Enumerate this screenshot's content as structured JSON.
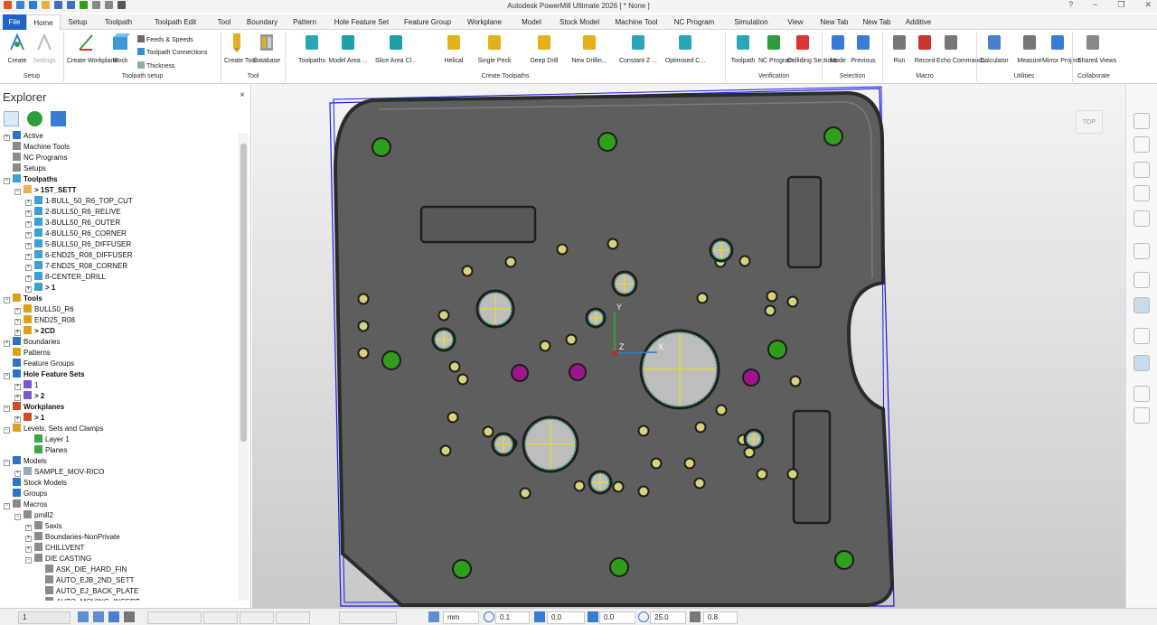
{
  "app_title": "Autodesk PowerMill Ultimate 2026   [ * None ]",
  "colors": {
    "accent": "#1e64c8",
    "viewport_part": "#5e5e5e",
    "hole_green": "#2f9e1a",
    "hole_magenta": "#a0148f",
    "bbox": "#1a1ae6"
  },
  "menu": {
    "tabs": [
      "File",
      "Home",
      "Setup",
      "Toolpath",
      "Toolpath Edit",
      "Tool",
      "Boundary",
      "Pattern",
      "Hole Feature Set",
      "Feature Group",
      "Workplane",
      "Model",
      "Stock Model",
      "Machine Tool",
      "NC Program",
      "Simulation",
      "View",
      "New Tab",
      "New Tab",
      "Additive"
    ],
    "active": "Home"
  },
  "ribbon": {
    "setup": {
      "create": "Create",
      "settings": "Settings",
      "group": "Setup"
    },
    "toolpath_setup": {
      "create_workplane": "Create Workplane",
      "block": "Block",
      "feeds": "Feeds & Speeds",
      "connections": "Toolpath Connections",
      "thickness": "Thickness",
      "group": "Toolpath setup"
    },
    "tool": {
      "create_tool": "Create Tool",
      "database": "Database",
      "group": "Tool"
    },
    "create_toolpaths": {
      "items": [
        "Toolpaths",
        "Model Area ...",
        "Slice Area Cl...",
        "Helical",
        "Single Peck",
        "Deep Drill",
        "New Drillin...",
        "Constant Z ...",
        "Optimised C..."
      ],
      "group": "Create Toolpaths"
    },
    "verification": {
      "items": [
        "Toolpath",
        "NC Program",
        "Colliding Sections"
      ],
      "group": "Verification"
    },
    "selection": {
      "items": [
        "Mode",
        "Previous"
      ],
      "group": "Selection"
    },
    "macro": {
      "items": [
        "Run",
        "Record",
        "Echo Commands"
      ],
      "group": "Macro"
    },
    "utilities": {
      "items": [
        "Calculator",
        "Measure",
        "Mirror Project"
      ],
      "group": "Utilities"
    },
    "collaborate": {
      "items": [
        "Shared Views"
      ],
      "group": "Collaborate"
    }
  },
  "explorer": {
    "title": "Explorer",
    "close": "×",
    "tree": [
      {
        "label": "Active",
        "level": 0,
        "bold": false,
        "icon": "#2e73c9",
        "toggle": "+"
      },
      {
        "label": "Machine Tools",
        "level": 0,
        "bold": false,
        "icon": "#8a8a8a",
        "toggle": ""
      },
      {
        "label": "NC Programs",
        "level": 0,
        "bold": false,
        "icon": "#8a8a8a",
        "toggle": ""
      },
      {
        "label": "Setups",
        "level": 0,
        "bold": false,
        "icon": "#8a8a8a",
        "toggle": ""
      },
      {
        "label": "Toolpaths",
        "level": 0,
        "bold": true,
        "icon": "#3aa1d8",
        "toggle": "−"
      },
      {
        "label": "> 1ST_SETT",
        "level": 1,
        "bold": true,
        "icon": "#e6b34a",
        "toggle": "−"
      },
      {
        "label": "1-BULL_50_R6_TOP_CUT",
        "level": 2,
        "bold": false,
        "icon": "#3aa1d8",
        "toggle": "+"
      },
      {
        "label": "2-BULL50_R6_RELIVE",
        "level": 2,
        "bold": false,
        "icon": "#3aa1d8",
        "toggle": "+"
      },
      {
        "label": "3-BULL50_R6_OUTER",
        "level": 2,
        "bold": false,
        "icon": "#3aa1d8",
        "toggle": "+"
      },
      {
        "label": "4-BULL50_R6_CORNER",
        "level": 2,
        "bold": false,
        "icon": "#3aa1d8",
        "toggle": "+"
      },
      {
        "label": "5-BULL50_R6_DIFFUSER",
        "level": 2,
        "bold": false,
        "icon": "#3aa1d8",
        "toggle": "+"
      },
      {
        "label": "6-END25_R08_DIFFUSER",
        "level": 2,
        "bold": false,
        "icon": "#3aa1d8",
        "toggle": "+"
      },
      {
        "label": "7-END25_R08_CORNER",
        "level": 2,
        "bold": false,
        "icon": "#3aa1d8",
        "toggle": "+"
      },
      {
        "label": "8-CENTER_DRILL",
        "level": 2,
        "bold": false,
        "icon": "#3aa1d8",
        "toggle": "+"
      },
      {
        "label": "> 1",
        "level": 2,
        "bold": true,
        "icon": "#3aa1d8",
        "toggle": "+"
      },
      {
        "label": "Tools",
        "level": 0,
        "bold": true,
        "icon": "#d9a21b",
        "toggle": "−"
      },
      {
        "label": "BULL50_R6",
        "level": 1,
        "bold": false,
        "icon": "#d9a21b",
        "toggle": "+"
      },
      {
        "label": "END25_R08",
        "level": 1,
        "bold": false,
        "icon": "#d9a21b",
        "toggle": "+"
      },
      {
        "label": "> 2CD",
        "level": 1,
        "bold": true,
        "icon": "#d9a21b",
        "toggle": "+"
      },
      {
        "label": "Boundaries",
        "level": 0,
        "bold": false,
        "icon": "#2e73c9",
        "toggle": "+"
      },
      {
        "label": "Patterns",
        "level": 0,
        "bold": false,
        "icon": "#d9a21b",
        "toggle": ""
      },
      {
        "label": "Feature Groups",
        "level": 0,
        "bold": false,
        "icon": "#2e73c9",
        "toggle": ""
      },
      {
        "label": "Hole Feature Sets",
        "level": 0,
        "bold": true,
        "icon": "#2e73c9",
        "toggle": "−"
      },
      {
        "label": "1",
        "level": 1,
        "bold": false,
        "icon": "#7a5bc9",
        "toggle": "+"
      },
      {
        "label": "> 2",
        "level": 1,
        "bold": true,
        "icon": "#7a5bc9",
        "toggle": "+"
      },
      {
        "label": "Workplanes",
        "level": 0,
        "bold": true,
        "icon": "#d04a2a",
        "toggle": "−"
      },
      {
        "label": "> 1",
        "level": 1,
        "bold": true,
        "icon": "#d04a2a",
        "toggle": "+"
      },
      {
        "label": "Levels, Sets and Clamps",
        "level": 0,
        "bold": false,
        "icon": "#e0a020",
        "toggle": "−"
      },
      {
        "label": "Layer 1",
        "level": 2,
        "bold": false,
        "icon": "#3aa845",
        "toggle": ""
      },
      {
        "label": "Planes",
        "level": 2,
        "bold": false,
        "icon": "#3aa845",
        "toggle": ""
      },
      {
        "label": "Models",
        "level": 0,
        "bold": false,
        "icon": "#2e73c9",
        "toggle": "−"
      },
      {
        "label": "SAMPLE_MOV-RICO",
        "level": 1,
        "bold": false,
        "icon": "#9ab",
        "toggle": "+"
      },
      {
        "label": "Stock Models",
        "level": 0,
        "bold": false,
        "icon": "#2e73c9",
        "toggle": ""
      },
      {
        "label": "Groups",
        "level": 0,
        "bold": false,
        "icon": "#2e73c9",
        "toggle": ""
      },
      {
        "label": "Macros",
        "level": 0,
        "bold": false,
        "icon": "#8a8a8a",
        "toggle": "−"
      },
      {
        "label": "pmill2",
        "level": 1,
        "bold": false,
        "icon": "#8a8a8a",
        "toggle": "−"
      },
      {
        "label": "5axis",
        "level": 2,
        "bold": false,
        "icon": "#8a8a8a",
        "toggle": "+"
      },
      {
        "label": "Boundaries-NonPrivate",
        "level": 2,
        "bold": false,
        "icon": "#8a8a8a",
        "toggle": "+"
      },
      {
        "label": "CHILLVENT",
        "level": 2,
        "bold": false,
        "icon": "#8a8a8a",
        "toggle": "+"
      },
      {
        "label": "DIE CASTING",
        "level": 2,
        "bold": false,
        "icon": "#8a8a8a",
        "toggle": "−"
      },
      {
        "label": "ASK_DIE_HARD_FIN",
        "level": 3,
        "bold": false,
        "icon": "#8a8a8a",
        "toggle": ""
      },
      {
        "label": "AUTO_EJB_2ND_SETT",
        "level": 3,
        "bold": false,
        "icon": "#8a8a8a",
        "toggle": ""
      },
      {
        "label": "AUTO_EJ_BACK_PLATE",
        "level": 3,
        "bold": false,
        "icon": "#8a8a8a",
        "toggle": ""
      },
      {
        "label": "AUTO_MOVING_INSERT",
        "level": 3,
        "bold": false,
        "icon": "#8a8a8a",
        "toggle": ""
      }
    ]
  },
  "viewport": {
    "view_cube": "TOP",
    "axis_y": "Y",
    "axis_x": "X",
    "axis_z": "Z"
  },
  "statusbar": {
    "layer": "1",
    "units": "mm",
    "tolerance": "0.1",
    "thickness": "0.0",
    "axial": "0.0",
    "diameter": "25.0",
    "length": "0.8"
  }
}
